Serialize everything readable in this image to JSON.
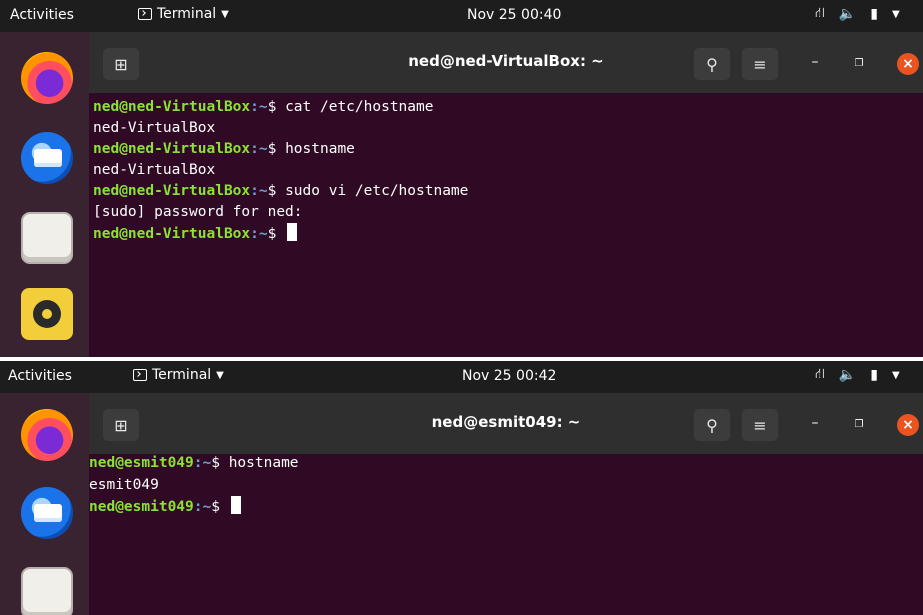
{
  "screens": [
    {
      "topbar": {
        "activities": "Activities",
        "app_menu": "Terminal",
        "clock": "Nov 25  00:40"
      },
      "window": {
        "title": "ned@ned-VirtualBox: ~"
      },
      "dock": [
        "firefox-icon",
        "thunderbird-icon",
        "files-icon",
        "rhythmbox-icon"
      ],
      "terminal": {
        "lines": [
          {
            "user": "ned@ned-VirtualBox",
            "path": ":~",
            "cmd": "$ cat /etc/hostname"
          },
          {
            "text": "ned-VirtualBox"
          },
          {
            "user": "ned@ned-VirtualBox",
            "path": ":~",
            "cmd": "$ hostname"
          },
          {
            "text": "ned-VirtualBox"
          },
          {
            "user": "ned@ned-VirtualBox",
            "path": ":~",
            "cmd": "$ sudo vi /etc/hostname"
          },
          {
            "text": "[sudo] password for ned:"
          },
          {
            "user": "ned@ned-VirtualBox",
            "path": ":~",
            "cmd": "$ "
          }
        ]
      }
    },
    {
      "topbar": {
        "activities": "Activities",
        "app_menu": "Terminal",
        "clock": "Nov 25  00:42"
      },
      "window": {
        "title": "ned@esmit049: ~"
      },
      "dock": [
        "firefox-icon",
        "thunderbird-icon",
        "files-icon"
      ],
      "terminal": {
        "lines": [
          {
            "user": "ned@esmit049",
            "path": ":~",
            "cmd": "$ hostname"
          },
          {
            "text": "esmit049"
          },
          {
            "user": "ned@esmit049",
            "path": ":~",
            "cmd": "$ "
          }
        ]
      }
    }
  ],
  "colors": {
    "terminal_bg": "#300a24",
    "prompt_user": "#8ae234",
    "prompt_path": "#729fcf",
    "close_button": "#e95420"
  }
}
